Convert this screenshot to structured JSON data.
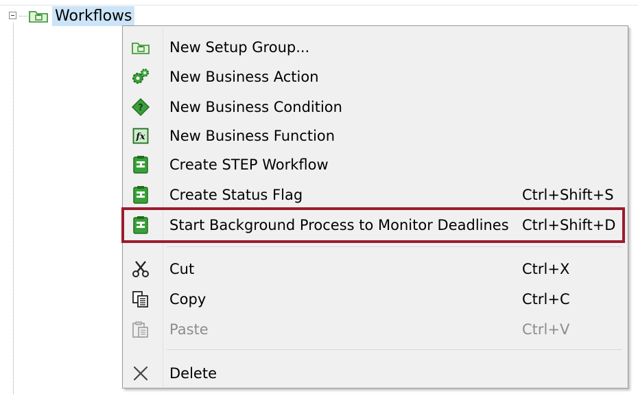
{
  "tree": {
    "node_label": "Workflows",
    "node_icon": "setup-group-folder-icon",
    "expander_state": "expanded"
  },
  "context_menu": {
    "items": [
      {
        "label": "New Setup Group...",
        "shortcut": "",
        "icon": "setup-group-folder-icon",
        "enabled": true
      },
      {
        "label": "New Business Action",
        "shortcut": "",
        "icon": "business-action-gears-icon",
        "enabled": true
      },
      {
        "label": "New Business Condition",
        "shortcut": "",
        "icon": "business-condition-diamond-icon",
        "enabled": true
      },
      {
        "label": "New Business Function",
        "shortcut": "",
        "icon": "business-function-fx-icon",
        "enabled": true
      },
      {
        "label": "Create STEP Workflow",
        "shortcut": "",
        "icon": "step-workflow-icon",
        "enabled": true
      },
      {
        "label": "Create Status Flag",
        "shortcut": "Ctrl+Shift+S",
        "icon": "status-flag-workflow-icon",
        "enabled": true
      },
      {
        "label": "Start Background Process to Monitor Deadlines",
        "shortcut": "Ctrl+Shift+D",
        "icon": "monitor-deadlines-workflow-icon",
        "enabled": true,
        "highlighted": true
      },
      {
        "label": "Cut",
        "shortcut": "Ctrl+X",
        "icon": "scissors-icon",
        "enabled": true
      },
      {
        "label": "Copy",
        "shortcut": "Ctrl+C",
        "icon": "copy-icon",
        "enabled": true
      },
      {
        "label": "Paste",
        "shortcut": "Ctrl+V",
        "icon": "paste-icon",
        "enabled": false
      },
      {
        "label": "Delete",
        "shortcut": "",
        "icon": "delete-x-icon",
        "enabled": true
      }
    ]
  },
  "colors": {
    "selection_bg": "#cce4f7",
    "menu_bg": "#f0f0f0",
    "highlight_border": "#9b1c2e",
    "icon_green": "#3aa03a",
    "disabled_text": "#8d8d8d"
  }
}
